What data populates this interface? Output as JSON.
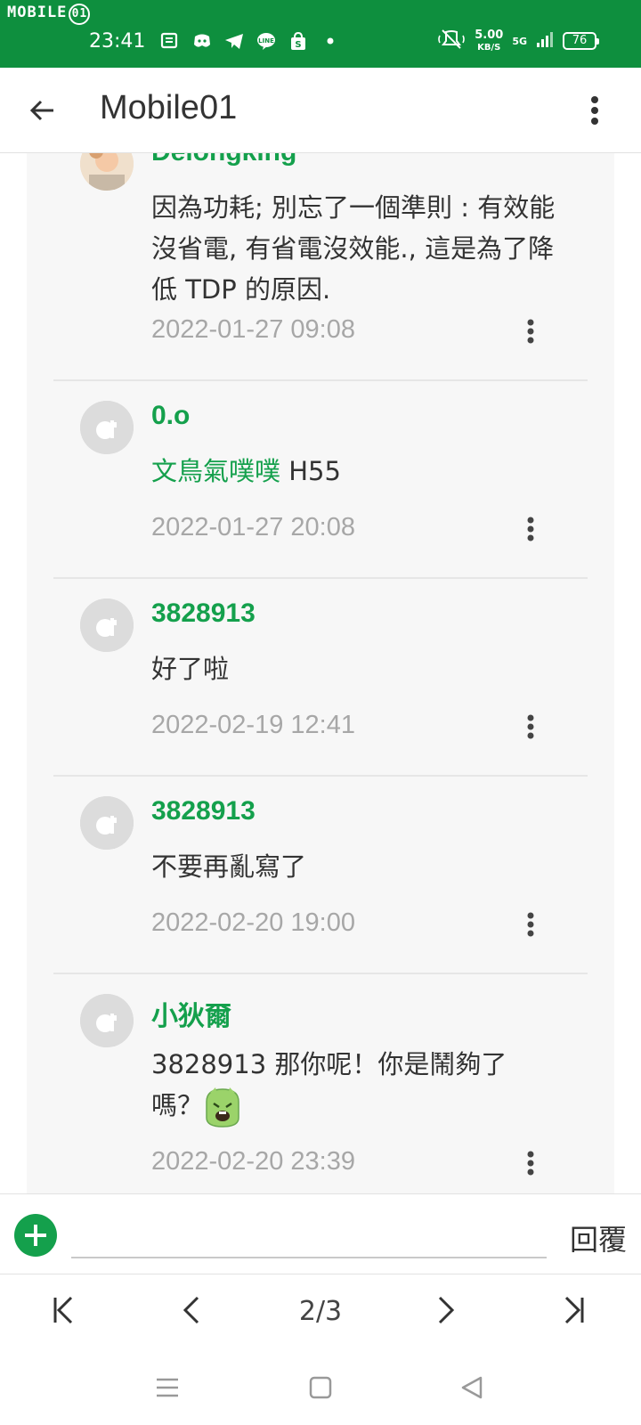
{
  "status": {
    "watermark": "MOBILE",
    "watermark_mark": "01",
    "time": "23:41",
    "speed_value": "5.00",
    "speed_unit": "KB/S",
    "network": "5G",
    "battery": "76"
  },
  "app_bar": {
    "title": "Mobile01",
    "back_icon": "arrow-left-icon",
    "menu_icon": "more-vertical-icon"
  },
  "comments": [
    {
      "author": "Delongking",
      "body": "因為功耗; 別忘了一個準則 : 有效能沒省電, 有省電沒效能., 這是為了降低 TDP 的原因.",
      "time": "2022-01-27 09:08"
    },
    {
      "author": "0.o",
      "mention": "文鳥氣噗噗",
      "body": " H55",
      "time": "2022-01-27 20:08"
    },
    {
      "author": "3828913",
      "body": "好了啦",
      "time": "2022-02-19 12:41"
    },
    {
      "author": "3828913",
      "body": "不要再亂寫了",
      "time": "2022-02-20 19:00"
    },
    {
      "author": "小狄爾",
      "body_line1": "3828913 那你呢！你是鬧夠了",
      "body_line2": "嗎？",
      "time": "2022-02-20 23:39"
    }
  ],
  "reply": {
    "placeholder": "",
    "send_label": "回覆"
  },
  "pager": {
    "current": "2/3"
  },
  "colors": {
    "brand_green": "#0e8f3e",
    "author_green": "#14a04c"
  }
}
